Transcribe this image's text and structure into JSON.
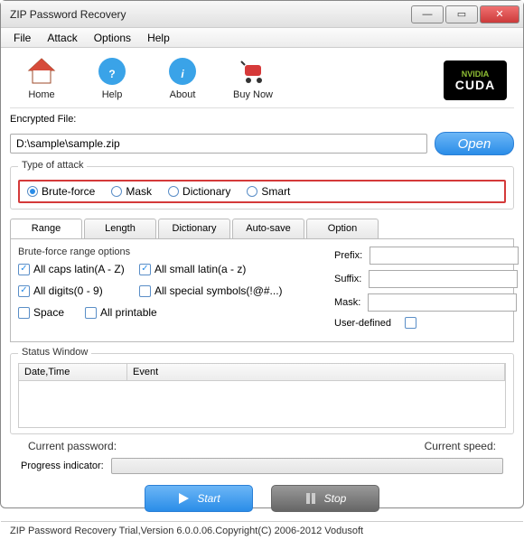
{
  "window": {
    "title": "ZIP Password Recovery"
  },
  "menu": {
    "file": "File",
    "attack": "Attack",
    "options": "Options",
    "help": "Help"
  },
  "toolbar": {
    "home": "Home",
    "help": "Help",
    "about": "About",
    "buynow": "Buy Now",
    "cuda_top": "NVIDIA",
    "cuda_bottom": "CUDA"
  },
  "file": {
    "label": "Encrypted File:",
    "path": "D:\\sample\\sample.zip",
    "open": "Open"
  },
  "attack": {
    "label": "Type of attack",
    "options": [
      "Brute-force",
      "Mask",
      "Dictionary",
      "Smart"
    ],
    "selected": 0
  },
  "tabs": [
    "Range",
    "Length",
    "Dictionary",
    "Auto-save",
    "Option"
  ],
  "range": {
    "heading": "Brute-force range options",
    "caps": "All caps latin(A - Z)",
    "small": "All small latin(a - z)",
    "digits": "All digits(0 - 9)",
    "symbols": "All special symbols(!@#...)",
    "space": "Space",
    "printable": "All printable",
    "caps_checked": true,
    "small_checked": true,
    "digits_checked": true,
    "symbols_checked": false,
    "space_checked": false,
    "printable_checked": false
  },
  "fields": {
    "prefix_label": "Prefix:",
    "prefix": "",
    "suffix_label": "Suffix:",
    "suffix": "",
    "mask_label": "Mask:",
    "mask": "",
    "userdef_label": "User-defined",
    "userdef_checked": false
  },
  "status": {
    "label": "Status Window",
    "col1": "Date,Time",
    "col2": "Event"
  },
  "info": {
    "cur_pwd_label": "Current password:",
    "cur_speed_label": "Current speed:",
    "progress_label": "Progress indicator:"
  },
  "buttons": {
    "start": "Start",
    "stop": "Stop"
  },
  "footer": "ZIP Password Recovery Trial,Version 6.0.0.06.Copyright(C) 2006-2012 Vodusoft"
}
